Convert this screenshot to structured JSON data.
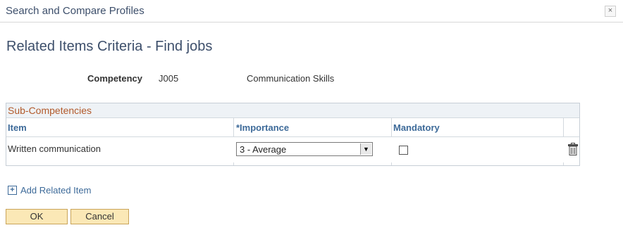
{
  "titlebar": {
    "title": "Search and Compare Profiles",
    "close_label": "×"
  },
  "page_title": "Related Items Criteria - Find jobs",
  "competency": {
    "label": "Competency",
    "code": "J005",
    "name": "Communication Skills"
  },
  "grid": {
    "caption": "Sub-Competencies",
    "columns": {
      "item": "Item",
      "importance": "*Importance",
      "mandatory": "Mandatory"
    },
    "rows": [
      {
        "item": "Written communication",
        "importance": "3 - Average",
        "mandatory": false
      }
    ]
  },
  "add_related_item": "Add Related Item",
  "buttons": {
    "ok": "OK",
    "cancel": "Cancel"
  },
  "icons": {
    "close": "close-icon",
    "dropdown": "chevron-down-icon",
    "delete": "trash-icon",
    "add": "plus-icon"
  },
  "colors": {
    "heading": "#3d4f6b",
    "link": "#3d6a99",
    "caption": "#b25a2b",
    "button_bg": "#fbe8b6"
  }
}
